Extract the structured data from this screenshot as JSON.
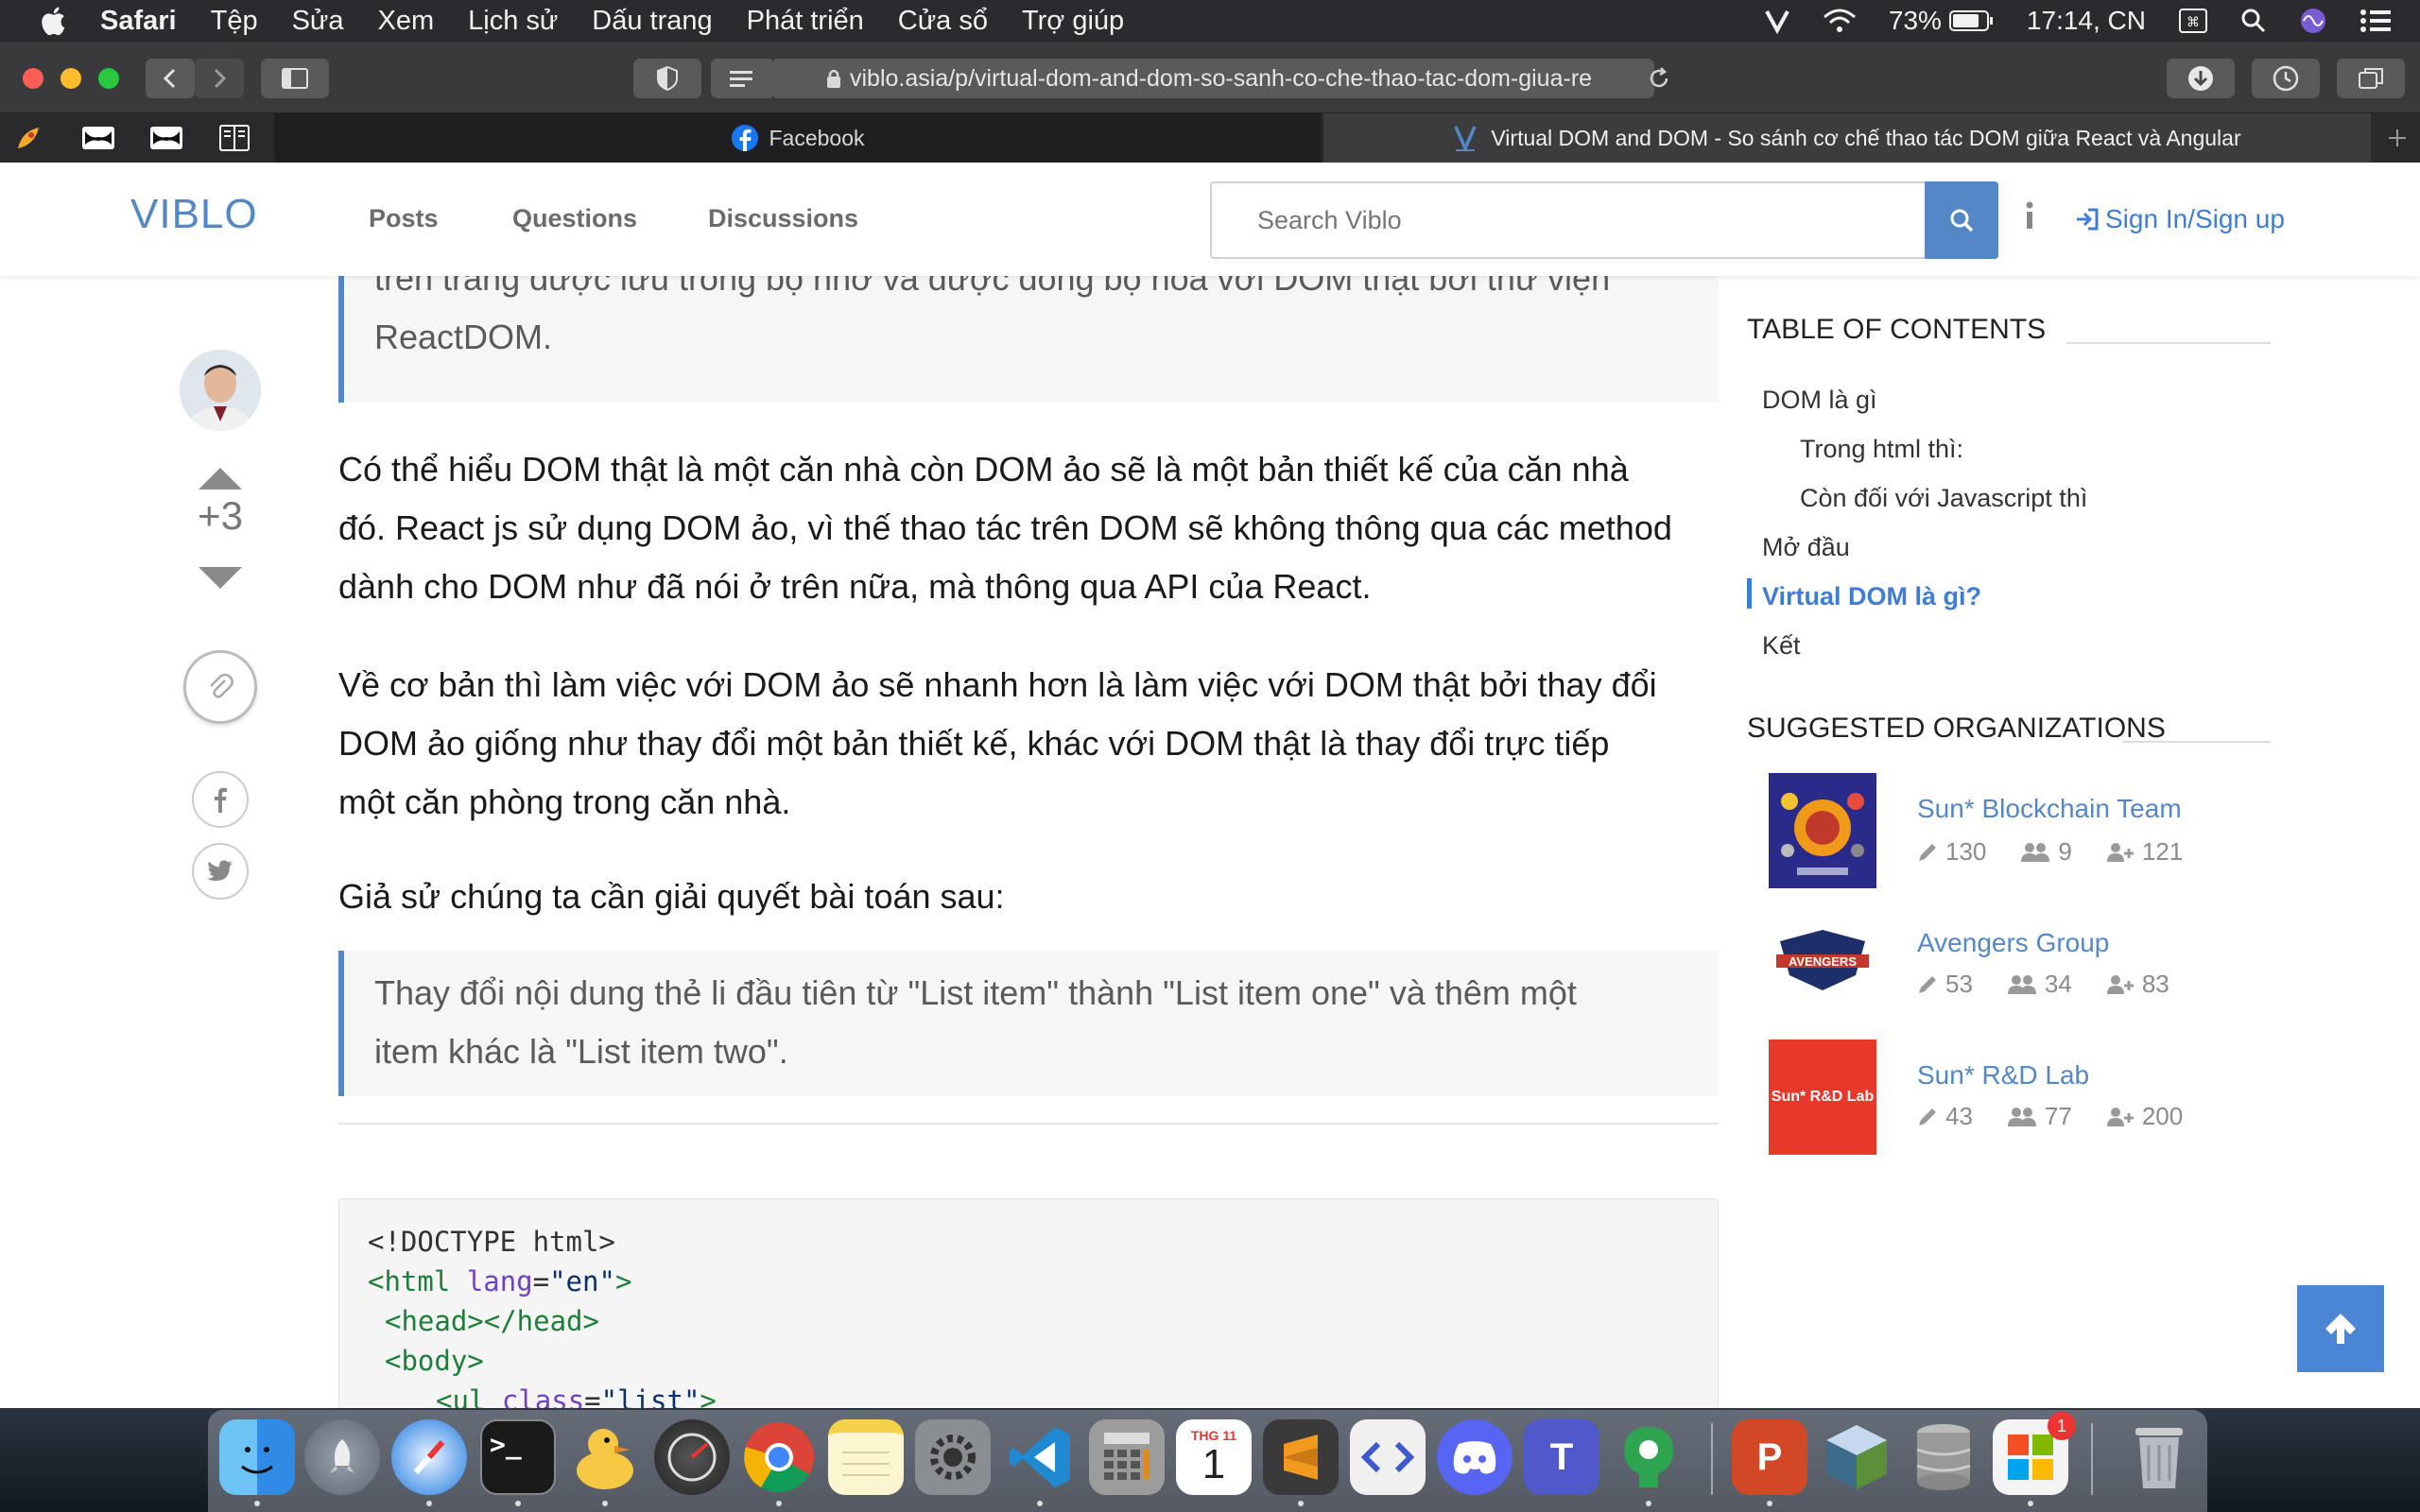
{
  "menubar": {
    "app": "Safari",
    "items": [
      "Tệp",
      "Sửa",
      "Xem",
      "Lịch sử",
      "Dấu trang",
      "Phát triển",
      "Cửa sổ",
      "Trợ giúp"
    ],
    "battery": "73%",
    "clock": "17:14, CN"
  },
  "toolbar": {
    "url": "viblo.asia/p/virtual-dom-and-dom-so-sanh-co-che-thao-tac-dom-giua-re"
  },
  "tabs": [
    {
      "label": "Facebook",
      "icon": "facebook-icon"
    },
    {
      "label": "Virtual DOM and DOM - So sánh cơ chế thao tác DOM giữa React và Angular",
      "icon": "viblo-icon"
    }
  ],
  "header": {
    "logo": "VIBLO",
    "nav": [
      "Posts",
      "Questions",
      "Discussions"
    ],
    "search_placeholder": "Search Viblo",
    "signin": "Sign In/Sign up"
  },
  "post": {
    "score": "+3",
    "quote_top_line1": "trên trang được lưu trong bộ nhớ và được đồng bộ hóa với DOM thật bởi thư viện",
    "quote_top_line2": "ReactDOM.",
    "para1_line1": "Có thể hiểu DOM thật là một căn nhà còn DOM ảo sẽ là một bản thiết kế của căn nhà",
    "para1_line2": "đó. React js sử dụng DOM ảo, vì thế thao tác trên DOM sẽ không thông qua các method",
    "para1_line3": "dành cho DOM như đã nói ở trên nữa, mà thông qua API của React.",
    "para2_line1": "Về cơ bản thì làm việc với DOM ảo sẽ nhanh hơn là làm việc với DOM thật bởi thay đổi",
    "para2_line2": "DOM ảo giống như thay đổi một bản thiết kế, khác với DOM thật là thay đổi trực tiếp",
    "para2_line3": "một căn phòng trong căn nhà.",
    "para3": "Giả sử chúng ta cần giải quyết bài toán sau:",
    "quote2_line1": "Thay đổi nội dung thẻ li đầu tiên từ \"List item\" thành \"List item one\" và thêm một",
    "quote2_line2": "item khác là \"List item two\".",
    "code": {
      "l1": "<!DOCTYPE html>",
      "l2_tag_open": "<html",
      "l2_attr": "lang",
      "l2_eq": "=",
      "l2_val": "\"en\"",
      "l2_close": ">",
      "l3": "<head></head>",
      "l4": "<body>",
      "l5_tag": "<ul",
      "l5_attr": "class",
      "l5_eq": "=",
      "l5_val": "\"list\"",
      "l5_close": ">"
    }
  },
  "toc": {
    "heading": "TABLE OF CONTENTS",
    "items": [
      {
        "label": "DOM là gì"
      },
      {
        "label": "Trong html thì:"
      },
      {
        "label": "Còn đối với Javascript thì"
      },
      {
        "label": "Mở đầu"
      },
      {
        "label": "Virtual DOM là gì?"
      },
      {
        "label": "Kết"
      }
    ],
    "active_index": 4
  },
  "orgs": {
    "heading": "SUGGESTED ORGANIZATIONS",
    "items": [
      {
        "name": "Sun* Blockchain Team",
        "posts": "130",
        "members": "9",
        "followers": "121"
      },
      {
        "name": "Avengers Group",
        "posts": "53",
        "members": "34",
        "followers": "83",
        "logo_text": "AVENGERS"
      },
      {
        "name": "Sun* R&D Lab",
        "posts": "43",
        "members": "77",
        "followers": "200",
        "logo_text": "Sun* R&D Lab"
      }
    ]
  },
  "dock": {
    "calendar_month": "THG 11",
    "calendar_day": "1",
    "teams_letter": "T",
    "ppt_letter": "P",
    "badge": "1"
  },
  "colors": {
    "accent": "#5387c6",
    "link": "#3d7dd8"
  }
}
